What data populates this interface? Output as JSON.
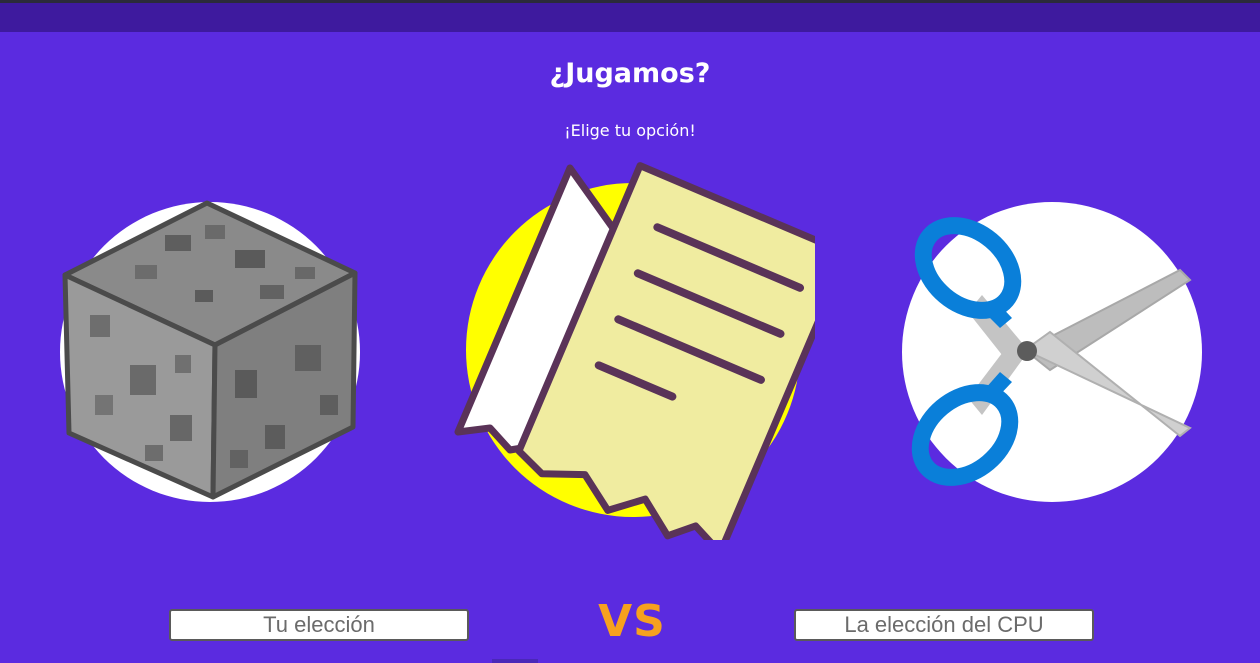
{
  "header": {
    "title": "¿Jugamos?",
    "subtitle": "¡Elige tu opción!"
  },
  "choices": [
    {
      "name": "rock",
      "icon": "stone-block-icon",
      "circle_color": "#ffffff"
    },
    {
      "name": "paper",
      "icon": "paper-sheet-icon",
      "circle_color": "#ffff00"
    },
    {
      "name": "scissors",
      "icon": "scissors-icon",
      "circle_color": "#ffffff"
    }
  ],
  "footer": {
    "player_choice_label": "Tu elección",
    "vs_label": "VS",
    "cpu_choice_label": "La elección del CPU"
  },
  "colors": {
    "background": "#5b2be0",
    "top_bar": "#3e1a9e",
    "vs_text": "#f7a11e",
    "scissors_handle": "#0a7fd9"
  }
}
